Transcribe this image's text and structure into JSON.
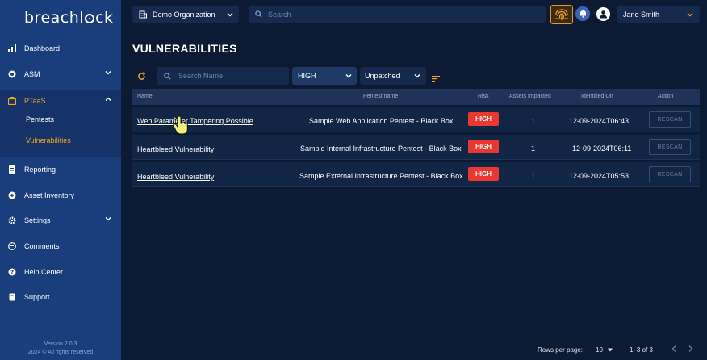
{
  "brand": {
    "name_pre": "breachl",
    "name_post": "ck"
  },
  "sidebar": {
    "items": [
      {
        "label": "Dashboard",
        "icon": "chart-icon"
      },
      {
        "label": "ASM",
        "icon": "target-icon"
      },
      {
        "label": "PTaaS",
        "icon": "briefcase-icon"
      },
      {
        "label": "Reporting",
        "icon": "report-icon"
      },
      {
        "label": "Asset Inventory",
        "icon": "asset-icon"
      },
      {
        "label": "Settings",
        "icon": "gear-icon"
      },
      {
        "label": "Comments",
        "icon": "comment-icon"
      },
      {
        "label": "Help Center",
        "icon": "help-icon"
      },
      {
        "label": "Support",
        "icon": "support-icon"
      }
    ],
    "sub_items": [
      {
        "label": "Pentests"
      },
      {
        "label": "Vulnerabilities"
      }
    ],
    "version": "Version 2.0.3",
    "copyright": "2024 © All rights reserved"
  },
  "topbar": {
    "organization": "Demo Organization",
    "search_placeholder": "Search",
    "user_name": "Jane Smith"
  },
  "page": {
    "title": "VULNERABILITIES"
  },
  "filters": {
    "search_placeholder": "Search Name",
    "risk_value": "HIGH",
    "status_value": "Unpatched"
  },
  "table": {
    "headers": [
      "Name",
      "Pentest name",
      "Risk",
      "Assets Impacted",
      "Identified On",
      "Action"
    ],
    "rows": [
      {
        "name": "Web Parameter Tampering Possible",
        "pentest": "Sample Web Application Pentest - Black Box",
        "risk": "HIGH",
        "assets": "1",
        "identified": "12-09-2024T06:43",
        "action": "RESCAN"
      },
      {
        "name": "Heartbleed Vulnerability",
        "pentest": "Sample Internal Infrastructure Pentest - Black Box",
        "risk": "HIGH",
        "assets": "1",
        "identified": "12-09-2024T06:11",
        "action": "RESCAN"
      },
      {
        "name": "Heartbleed Vulnerability",
        "pentest": "Sample External Infrastructure Pentest - Black Box",
        "risk": "HIGH",
        "assets": "1",
        "identified": "12-09-2024T05:53",
        "action": "RESCAN"
      }
    ]
  },
  "pagination": {
    "rows_per_page_label": "Rows per page:",
    "rows_per_page": "10",
    "range": "1–3 of 3"
  },
  "colors": {
    "accent": "#f5a623",
    "sidebar": "#1a3d7c",
    "background": "#0c1a33",
    "risk_high": "#e8382f"
  }
}
